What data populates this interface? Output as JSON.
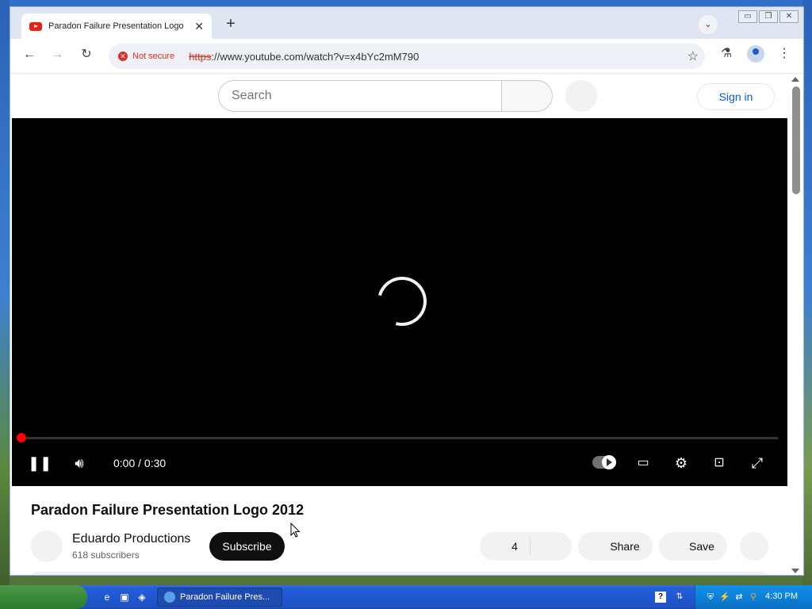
{
  "browser": {
    "tab_title": "Paradon Failure Presentation Logo",
    "not_secure_label": "Not secure",
    "url_protocol": "https",
    "url_rest": "://www.youtube.com/watch?v=x4bYc2mM790"
  },
  "youtube": {
    "search_placeholder": "Search",
    "sign_in_label": "Sign in"
  },
  "player": {
    "timecode": "0:00 / 0:30",
    "progress": 0
  },
  "video": {
    "title": "Paradon Failure Presentation Logo 2012",
    "channel_name": "Eduardo Productions",
    "subscribers": "618 subscribers",
    "subscribe_label": "Subscribe",
    "like_count": "4",
    "share_label": "Share",
    "save_label": "Save"
  },
  "taskbar": {
    "task_label": "Paradon Failure Pres...",
    "clock": "4:30 PM"
  }
}
